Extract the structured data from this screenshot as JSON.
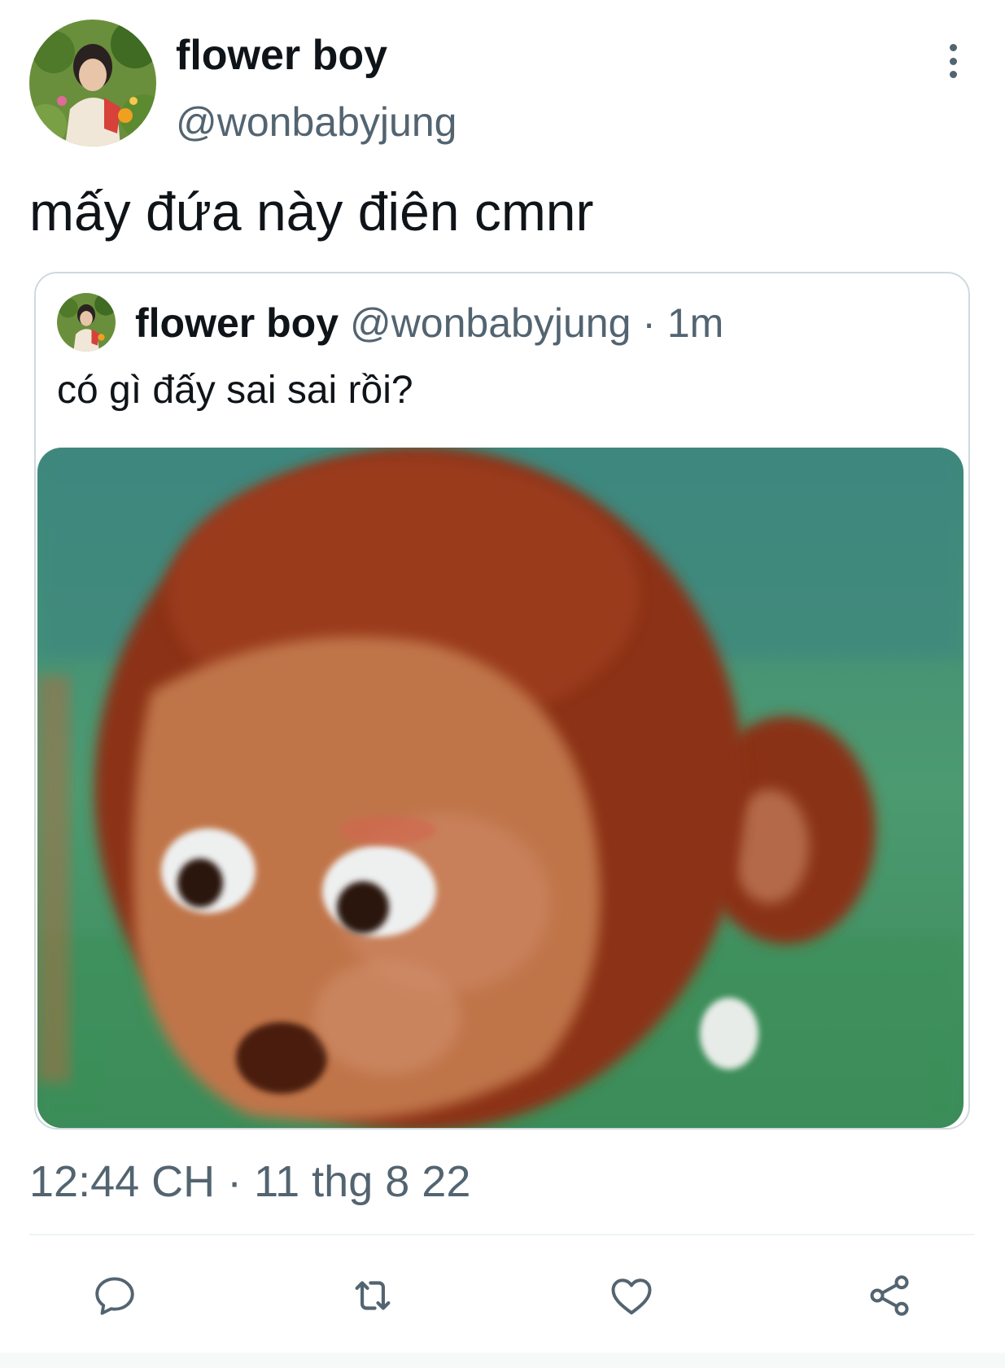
{
  "tweet": {
    "author_name": "flower boy",
    "author_handle": "@wonbabyjung",
    "text": "mấy đứa này điên cmnr",
    "timestamp": "12:44 CH · 11 thg 8 22"
  },
  "quoted_tweet": {
    "author_name": "flower boy",
    "author_handle": "@wonbabyjung",
    "separator": "·",
    "time": "1m",
    "text": "có gì đấy sai sai rồi?"
  },
  "icons": {
    "more": "more-vertical-icon",
    "reply": "reply-icon",
    "retweet": "retweet-icon",
    "like": "heart-icon",
    "share": "share-icon"
  },
  "colors": {
    "text_primary": "#0f1419",
    "text_secondary": "#536471",
    "border": "#cfd9de"
  }
}
